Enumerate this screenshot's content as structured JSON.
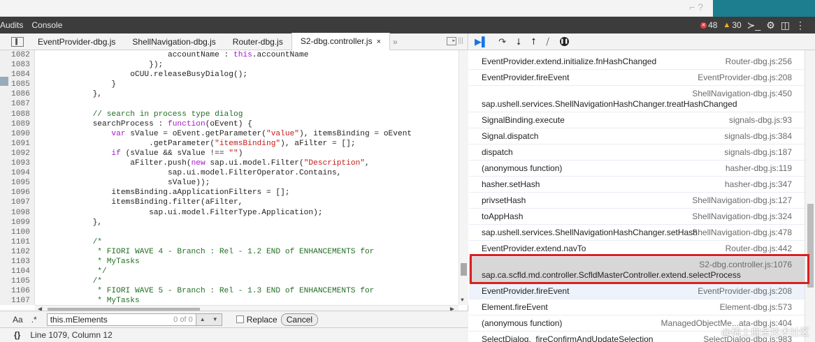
{
  "topbar": {
    "ghost_glyphs": "⌐ ?"
  },
  "main_toolbar": {
    "tabs": [
      "Audits",
      "Console"
    ],
    "errors": "48",
    "warnings": "30",
    "console_icon": "console-prompt-icon",
    "settings_icon": "gear-icon",
    "dock_icon": "dock-side-icon",
    "menu_icon": "kebab-menu-icon"
  },
  "file_tabs": [
    {
      "label": "EventProvider-dbg.js"
    },
    {
      "label": "ShellNavigation-dbg.js"
    },
    {
      "label": "Router-dbg.js"
    },
    {
      "label": "S2-dbg.controller.js",
      "close": "×"
    }
  ],
  "more_tabs": "»",
  "code_lines": [
    {
      "n": "1082",
      "html": "                            accountName : <span class=\"kw\">this</span>.accountName"
    },
    {
      "n": "1083",
      "html": "                        });"
    },
    {
      "n": "1084",
      "html": "                    oCUU.releaseBusyDialog();"
    },
    {
      "n": "1085",
      "html": "                }"
    },
    {
      "n": "1086",
      "html": "            },"
    },
    {
      "n": "1087",
      "html": ""
    },
    {
      "n": "1088",
      "html": "            <span class=\"cm\">// search in process type dialog</span>"
    },
    {
      "n": "1089",
      "html": "            searchProcess : <span class=\"kw\">function</span>(oEvent) {"
    },
    {
      "n": "1090",
      "html": "                <span class=\"kw\">var</span> sValue = oEvent.getParameter(<span class=\"str\">\"value\"</span>), itemsBinding = oEvent"
    },
    {
      "n": "1091",
      "html": "                        .getParameter(<span class=\"str\">\"itemsBinding\"</span>), aFilter = [];"
    },
    {
      "n": "1092",
      "html": "                <span class=\"kw\">if</span> (sValue &amp;&amp; sValue !== <span class=\"str\">\"\"</span>)"
    },
    {
      "n": "1093",
      "html": "                    aFilter.push(<span class=\"kw\">new</span> sap.ui.model.Filter(<span class=\"str\">\"Description\"</span>,"
    },
    {
      "n": "1094",
      "html": "                            sap.ui.model.FilterOperator.Contains,"
    },
    {
      "n": "1095",
      "html": "                            sValue));"
    },
    {
      "n": "1096",
      "html": "                itemsBinding.aApplicationFilters = [];"
    },
    {
      "n": "1097",
      "html": "                itemsBinding.filter(aFilter,"
    },
    {
      "n": "1098",
      "html": "                        sap.ui.model.FilterType.Application);"
    },
    {
      "n": "1099",
      "html": "            },"
    },
    {
      "n": "1100",
      "html": ""
    },
    {
      "n": "1101",
      "html": "            <span class=\"cm\">/*</span>"
    },
    {
      "n": "1102",
      "html": "<span class=\"cm\">             * FIORI WAVE 4 - Branch : Rel - 1.2 END of ENHANCEMENTS for</span>"
    },
    {
      "n": "1103",
      "html": "<span class=\"cm\">             * MyTasks</span>"
    },
    {
      "n": "1104",
      "html": "<span class=\"cm\">             */</span>"
    },
    {
      "n": "1105",
      "html": "            <span class=\"cm\">/*</span>"
    },
    {
      "n": "1106",
      "html": "<span class=\"cm\">             * FIORI WAVE 5 - Branch : Rel - 1.3 END of ENHANCEMENTS for</span>"
    },
    {
      "n": "1107",
      "html": "<span class=\"cm\">             * MyTasks</span>"
    }
  ],
  "search": {
    "case_toggle": "Aa",
    "regex_toggle": ".*",
    "value": "this.mElements",
    "count": "0 of 0",
    "replace_label": "Replace",
    "cancel_label": "Cancel"
  },
  "status": {
    "pretty_print": "{}",
    "position": "Line 1079, Column 12"
  },
  "debugger_toolbar": [
    "resume-icon",
    "step-over-icon",
    "step-into-icon",
    "step-out-icon",
    "deactivate-breakpoints-icon",
    "pause-on-exceptions-icon"
  ],
  "call_stack": [
    {
      "fn": "EventProvider.extend.initialize.fnHashChanged",
      "loc": "Router-dbg.js:256",
      "tall": false
    },
    {
      "fn": "EventProvider.fireEvent",
      "loc": "EventProvider-dbg.js:208",
      "tall": false
    },
    {
      "fn": "sap.ushell.services.ShellNavigationHashChanger.treatHashChanged",
      "loc": "ShellNavigation-dbg.js:450",
      "tall": true
    },
    {
      "fn": "SignalBinding.execute",
      "loc": "signals-dbg.js:93",
      "tall": false
    },
    {
      "fn": "Signal.dispatch",
      "loc": "signals-dbg.js:384",
      "tall": false
    },
    {
      "fn": "dispatch",
      "loc": "signals-dbg.js:187",
      "tall": false
    },
    {
      "fn": "(anonymous function)",
      "loc": "hasher-dbg.js:119",
      "tall": false
    },
    {
      "fn": "hasher.setHash",
      "loc": "hasher-dbg.js:347",
      "tall": false
    },
    {
      "fn": "privsetHash",
      "loc": "ShellNavigation-dbg.js:127",
      "tall": false
    },
    {
      "fn": "toAppHash",
      "loc": "ShellNavigation-dbg.js:324",
      "tall": false
    },
    {
      "fn": "sap.ushell.services.ShellNavigationHashChanger.setHash",
      "loc": "ShellNavigation-dbg.js:478",
      "tall": false
    },
    {
      "fn": "EventProvider.extend.navTo",
      "loc": "Router-dbg.js:442",
      "tall": false
    },
    {
      "fn": "sap.ca.scfld.md.controller.ScfldMasterController.extend.selectProcess",
      "loc": "S2-dbg.controller.js:1076",
      "tall": true,
      "selected": true
    },
    {
      "fn": "EventProvider.fireEvent",
      "loc": "EventProvider-dbg.js:208",
      "tall": false
    },
    {
      "fn": "Element.fireEvent",
      "loc": "Element-dbg.js:573",
      "tall": false
    },
    {
      "fn": "(anonymous function)",
      "loc": "ManagedObjectMe...ata-dbg.js:404",
      "tall": false
    },
    {
      "fn": "SelectDialog._fireConfirmAndUpdateSelection",
      "loc": "SelectDialog-dbg.js:983",
      "tall": false
    }
  ],
  "watermark": "@稀土掘金技术社区",
  "colors": {
    "highlight_border": "#d92020",
    "toolbar_dark": "#3c3c3c",
    "teal": "#1d7e8f"
  }
}
